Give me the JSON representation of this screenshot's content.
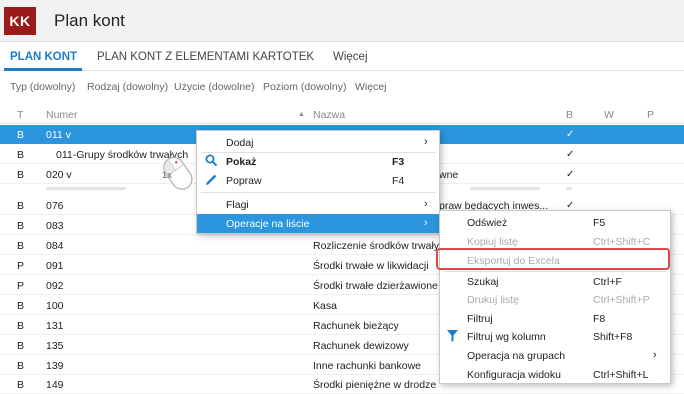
{
  "app": {
    "logo": "KK",
    "title": "Plan kont"
  },
  "tabs": [
    {
      "label": "PLAN KONT",
      "active": true
    },
    {
      "label": "PLAN KONT Z ELEMENTAMI KARTOTEK",
      "active": false
    },
    {
      "label": "Więcej",
      "active": false
    }
  ],
  "filters": [
    "Typ (dowolny)",
    "Rodzaj (dowolny)",
    "Użycie (dowolne)",
    "Poziom (dowolny)",
    "Więcej"
  ],
  "columns": {
    "t": "T",
    "numer": "Numer",
    "nazwa": "Nazwa",
    "b": "B",
    "w": "W",
    "p": "P",
    "sort_icon": "sort-asc-icon"
  },
  "rows": [
    {
      "t": "B",
      "numer": "011 v",
      "nazwa": "",
      "b": "✓",
      "selected": true
    },
    {
      "t": "B",
      "numer": "011-Grupy środków trwałych",
      "nazwa": "",
      "b": "✓"
    },
    {
      "t": "B",
      "numer": "020 v",
      "nazwa": "wne",
      "b": "✓"
    },
    {
      "t": "B",
      "numer": "076",
      "nazwa": "praw będących inwes...",
      "b": "✓"
    },
    {
      "t": "B",
      "numer": "083",
      "nazwa": "",
      "b": ""
    },
    {
      "t": "B",
      "numer": "084",
      "nazwa": "Rozliczenie środków trwałyc",
      "b": ""
    },
    {
      "t": "P",
      "numer": "091",
      "nazwa": "Środki trwałe w likwidacji",
      "b": ""
    },
    {
      "t": "P",
      "numer": "092",
      "nazwa": "Środki trwałe dzierżawione i",
      "b": ""
    },
    {
      "t": "B",
      "numer": "100",
      "nazwa": "Kasa",
      "b": ""
    },
    {
      "t": "B",
      "numer": "131",
      "nazwa": "Rachunek bieżący",
      "b": ""
    },
    {
      "t": "B",
      "numer": "135",
      "nazwa": "Rachunek dewizowy",
      "b": ""
    },
    {
      "t": "B",
      "numer": "139",
      "nazwa": "Inne rachunki bankowe",
      "b": ""
    },
    {
      "t": "B",
      "numer": "149",
      "nazwa": "Środki pieniężne w drodze",
      "b": ""
    }
  ],
  "context_menu": {
    "items": [
      {
        "label": "Dodaj",
        "shortcut": "",
        "submenu": true
      },
      {
        "label": "Pokaż",
        "shortcut": "F3",
        "icon": "search-icon",
        "bold": true
      },
      {
        "label": "Popraw",
        "shortcut": "F4",
        "icon": "pencil-icon"
      },
      {
        "label": "Flagi",
        "shortcut": "",
        "submenu": true
      },
      {
        "label": "Operacje na liście",
        "shortcut": "",
        "submenu": true,
        "hover": true
      }
    ]
  },
  "submenu": {
    "items": [
      {
        "label": "Odśwież",
        "shortcut": "F5"
      },
      {
        "label": "Kopiuj listę",
        "shortcut": "Ctrl+Shift+C",
        "disabled": true
      },
      {
        "label": "Eksportuj do Excela",
        "shortcut": "",
        "disabled": true,
        "highlighted": true
      },
      {
        "label": "Szukaj",
        "shortcut": "Ctrl+F"
      },
      {
        "label": "Drukuj listę",
        "shortcut": "Ctrl+Shift+P",
        "disabled": true
      },
      {
        "label": "Filtruj",
        "shortcut": "F8"
      },
      {
        "label": "Filtruj wg kolumn",
        "shortcut": "Shift+F8",
        "icon": "filter-icon"
      },
      {
        "label": "Operacja na grupach",
        "shortcut": "",
        "submenu": true
      },
      {
        "label": "Konfiguracja widoku",
        "shortcut": "Ctrl+Shift+L"
      }
    ]
  },
  "mouse_badge": "1x",
  "colors": {
    "accent": "#1d7dc9",
    "selection": "#2b96dd",
    "logo": "#9b1b1b",
    "highlight": "#d94a4a"
  }
}
